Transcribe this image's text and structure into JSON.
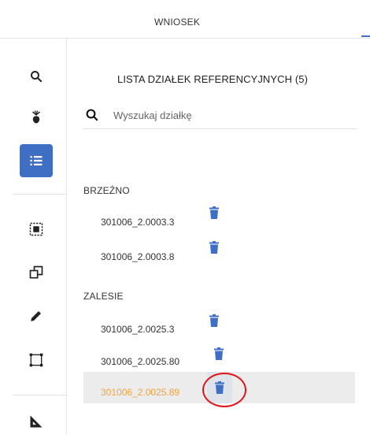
{
  "header": {
    "title": "WNIOSEK"
  },
  "toolbar": {
    "icons": [
      "search-icon",
      "crop-icon",
      "list-icon",
      "select-area-icon",
      "copy-shape-icon",
      "edit-icon",
      "bounding-box-icon",
      "measure-icon"
    ],
    "active_color": "#3f6fc4"
  },
  "panel": {
    "title": "LISTA DZIAŁEK REFERENCYJNYCH (5)",
    "search": {
      "placeholder": "Wyszukaj działkę",
      "value": ""
    },
    "groups": [
      {
        "label": "BRZEŹNO",
        "items": [
          {
            "label": "301006_2.0003.3"
          },
          {
            "label": "301006_2.0003.8"
          }
        ]
      },
      {
        "label": "ZALESIE",
        "items": [
          {
            "label": "301006_2.0025.3"
          },
          {
            "label": "301006_2.0025.80"
          },
          {
            "label": "301006_2.0025.89",
            "selected": true
          }
        ]
      }
    ]
  },
  "colors": {
    "accent": "#3f6fc4",
    "selected_text": "#f4a23e",
    "highlight": "#e0141d"
  }
}
